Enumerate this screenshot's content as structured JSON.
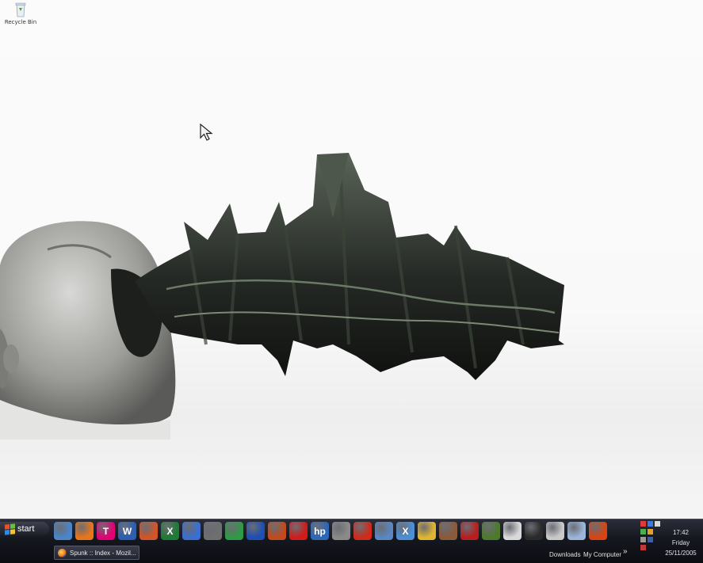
{
  "desktop": {
    "icons": [
      {
        "label": "Recycle Bin",
        "icon": "recycle-bin-icon"
      }
    ]
  },
  "taskbar": {
    "start_label": "start",
    "quick_launch": [
      {
        "name": "show-desktop-icon",
        "glyph": "",
        "color": "#4a86c8"
      },
      {
        "name": "firefox-icon",
        "glyph": "",
        "color": "#e8751a"
      },
      {
        "name": "t-mobile-icon",
        "glyph": "T",
        "color": "#e20074"
      },
      {
        "name": "word-icon",
        "glyph": "W",
        "color": "#2b5fb3"
      },
      {
        "name": "powerpoint-icon",
        "glyph": "",
        "color": "#d2552a"
      },
      {
        "name": "excel-icon",
        "glyph": "X",
        "color": "#1e7a34"
      },
      {
        "name": "media-player-icon",
        "glyph": "",
        "color": "#3a6fd1"
      },
      {
        "name": "scanner-icon",
        "glyph": "",
        "color": "#6f6f6f"
      },
      {
        "name": "cd-burner-icon",
        "glyph": "",
        "color": "#2f9a45"
      },
      {
        "name": "bluetooth-icon",
        "glyph": "",
        "color": "#1d4fb4"
      },
      {
        "name": "paint-icon",
        "glyph": "",
        "color": "#c24a1c"
      },
      {
        "name": "acrobat-icon",
        "glyph": "",
        "color": "#d31b1b"
      },
      {
        "name": "hp-icon",
        "glyph": "hp",
        "color": "#2e67b8"
      },
      {
        "name": "pen-tool-icon",
        "glyph": "",
        "color": "#8a8a8a"
      },
      {
        "name": "hammer-icon",
        "glyph": "",
        "color": "#cf2a1a"
      },
      {
        "name": "window-app-icon",
        "glyph": "",
        "color": "#5a86c2"
      },
      {
        "name": "x-app-icon",
        "glyph": "X",
        "color": "#4b8fd6"
      },
      {
        "name": "connect-icon",
        "glyph": "",
        "color": "#e0b530"
      },
      {
        "name": "game-character-icon",
        "glyph": "",
        "color": "#8b5a3a"
      },
      {
        "name": "crosshair-game-icon",
        "glyph": "",
        "color": "#b81e1e"
      },
      {
        "name": "quake-icon",
        "glyph": "",
        "color": "#4d7a2c"
      },
      {
        "name": "wolf-game-icon",
        "glyph": "",
        "color": "#d9d9d9"
      },
      {
        "name": "steam-icon",
        "glyph": "",
        "color": "#2a2a2a"
      },
      {
        "name": "wings-game-icon",
        "glyph": "",
        "color": "#c9c9c9"
      },
      {
        "name": "wings-game-2-icon",
        "glyph": "",
        "color": "#9bb6d8"
      },
      {
        "name": "shield-game-icon",
        "glyph": "",
        "color": "#d84512"
      }
    ],
    "active_task": "Spunk :: Index - Mozil...",
    "toolbars": {
      "downloads": "Downloads",
      "my_computer": "My Computer",
      "chevron": "»"
    },
    "clock": {
      "time": "17:42",
      "day": "Friday",
      "date": "25/11/2005"
    }
  }
}
